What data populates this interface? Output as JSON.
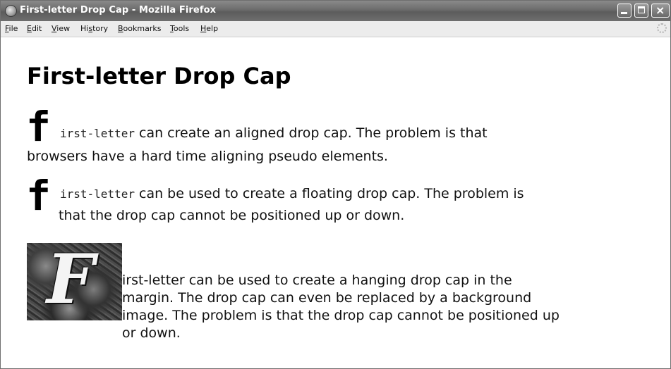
{
  "window": {
    "title": "First-letter Drop Cap - Mozilla Firefox"
  },
  "menubar": {
    "items": [
      {
        "accel": "F",
        "rest": "ile"
      },
      {
        "accel": "E",
        "rest": "dit"
      },
      {
        "accel": "V",
        "rest": "iew"
      },
      {
        "pre": "Hi",
        "accel": "s",
        "rest": "tory"
      },
      {
        "accel": "B",
        "rest": "ookmarks"
      },
      {
        "accel": "T",
        "rest": "ools"
      },
      {
        "accel": "H",
        "rest": "elp"
      }
    ]
  },
  "page": {
    "heading": "First-letter Drop Cap",
    "paragraphs": [
      {
        "dropcap": "f",
        "mono": "irst-letter",
        "line1_rest": " can create an aligned drop cap. The problem is that",
        "line2": "browsers have a hard time aligning pseudo elements."
      },
      {
        "dropcap": "f",
        "mono": "irst-letter",
        "line1_rest": " can be used to create a floating drop cap. The problem is",
        "line2": "that the drop cap cannot be positioned up or down."
      },
      {
        "image_letter": "F",
        "lines": [
          "irst-letter can be used to create a hanging drop cap in the",
          "margin. The drop cap can even be replaced by a background",
          "image. The problem is that the drop cap cannot be positioned up",
          "or down."
        ]
      }
    ]
  }
}
